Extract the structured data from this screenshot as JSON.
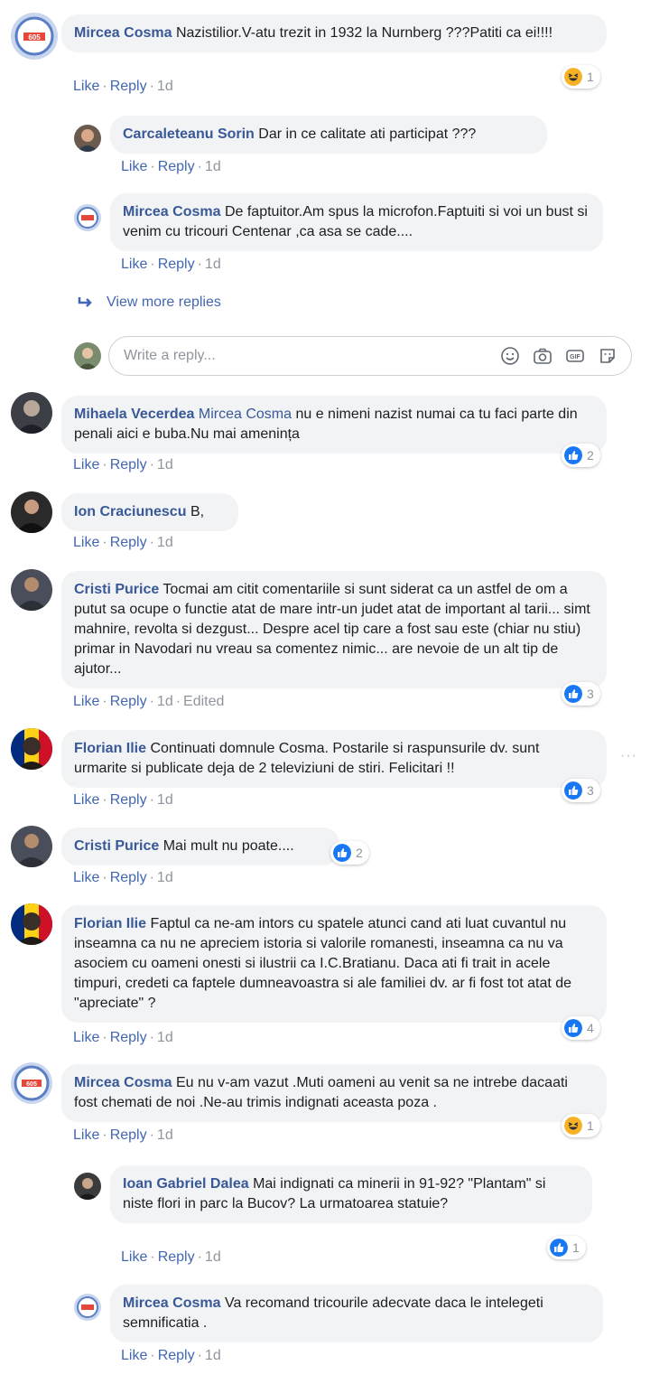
{
  "actions": {
    "like": "Like",
    "reply": "Reply",
    "sep": "·"
  },
  "comments": [
    {
      "author": "Mircea Cosma",
      "text": "Nazistilior.V-atu trezit in 1932 la Nurnberg ???Patiti ca ei!!!!",
      "time": "1d",
      "reaction": {
        "type": "haha",
        "count": "1"
      }
    },
    {
      "author": "Carcaleteanu Sorin",
      "text": "Dar in ce calitate ati participat ???",
      "time": "1d"
    },
    {
      "author": "Mircea Cosma",
      "text": "De faptuitor.Am spus la microfon.Faptuiti si voi un bust si venim cu tricouri Centenar ,ca asa se cade....",
      "time": "1d"
    },
    {
      "author": "Mihaela Vecerdea",
      "mention": "Mircea Cosma",
      "text": "nu e nimeni nazist numai ca tu faci parte din penali aici e buba.Nu mai amenința",
      "time": "1d",
      "reaction": {
        "type": "like",
        "count": "2"
      }
    },
    {
      "author": "Ion Craciunescu",
      "text": "B,",
      "time": "1d"
    },
    {
      "author": "Cristi Purice",
      "text": "Tocmai am citit comentariile si sunt siderat ca un astfel de om a putut sa ocupe o functie atat de mare intr-un judet atat de important al tarii... simt mahnire, revolta si dezgust... Despre acel tip care a fost sau este (chiar nu stiu) primar in Navodari nu vreau sa comentez nimic... are nevoie de un alt tip de ajutor...",
      "time": "1d",
      "edited": "Edited",
      "reaction": {
        "type": "like",
        "count": "3"
      }
    },
    {
      "author": "Florian Ilie",
      "text": "Continuati domnule Cosma. Postarile si raspunsurile dv. sunt urmarite si publicate deja de 2 televiziuni de stiri. Felicitari !!",
      "time": "1d",
      "reaction": {
        "type": "like",
        "count": "3"
      },
      "more": "···"
    },
    {
      "author": "Cristi Purice",
      "text": "Mai mult nu poate....",
      "time": "1d",
      "reaction": {
        "type": "like",
        "count": "2"
      }
    },
    {
      "author": "Florian Ilie",
      "text": "Faptul ca ne-am intors cu spatele atunci cand ati luat cuvantul nu inseamna ca nu ne apreciem istoria si valorile romanesti, inseamna ca nu va asociem cu oameni onesti si ilustrii ca I.C.Bratianu. Daca ati fi trait in acele timpuri, credeti ca faptele dumneavoastra si ale familiei dv. ar fi fost tot atat de \"apreciate\" ?",
      "time": "1d",
      "reaction": {
        "type": "like",
        "count": "4"
      }
    },
    {
      "author": "Mircea Cosma",
      "text": "Eu nu v-am vazut .Muti oameni au venit sa ne intrebe dacaati fost chemati de noi .Ne-au trimis indignati aceasta poza .",
      "time": "1d",
      "reaction": {
        "type": "haha",
        "count": "1"
      }
    },
    {
      "author": "Ioan Gabriel Dalea",
      "text": "Mai indignati ca minerii in 91-92? \"Plantam\" si niste flori in parc la Bucov? La urmatoarea statuie?",
      "time": "1d",
      "reaction": {
        "type": "like",
        "count": "1"
      }
    },
    {
      "author": "Mircea Cosma",
      "text": "Va recomand tricourile adecvate daca le intelegeti semnificatia .",
      "time": "1d"
    }
  ],
  "view_more": "View more replies",
  "reply_box": {
    "placeholder": "Write a reply..."
  },
  "colors": {
    "link": "#385898",
    "action": "#4267b2",
    "meta": "#90949c",
    "bubble": "#f2f3f5",
    "like": "#1877f2",
    "haha": "#f7b125"
  },
  "icons": [
    "reply-arrow-icon",
    "emoji-icon",
    "camera-icon",
    "gif-icon",
    "sticker-icon",
    "like-reaction-icon",
    "haha-reaction-icon",
    "more-options-icon"
  ]
}
